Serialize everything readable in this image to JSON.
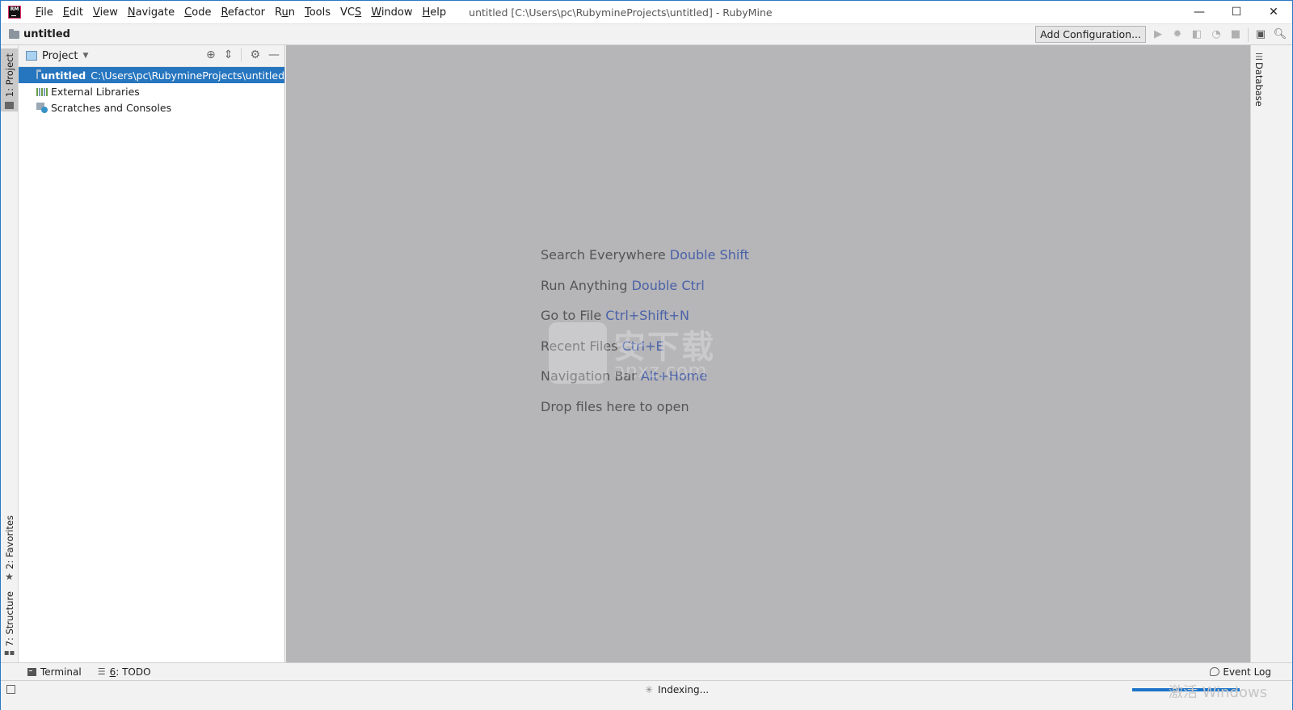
{
  "titlebar": {
    "app_logo": "RM",
    "menu": [
      {
        "label": "File",
        "mnemonic": "F",
        "rest": "ile"
      },
      {
        "label": "Edit",
        "mnemonic": "E",
        "rest": "dit"
      },
      {
        "label": "View",
        "mnemonic": "V",
        "rest": "iew"
      },
      {
        "label": "Navigate",
        "mnemonic": "N",
        "rest": "avigate"
      },
      {
        "label": "Code",
        "mnemonic": "C",
        "rest": "ode"
      },
      {
        "label": "Refactor",
        "mnemonic": "R",
        "rest": "efactor"
      },
      {
        "label": "Run",
        "pre": "R",
        "mnemonic": "u",
        "rest": "n"
      },
      {
        "label": "Tools",
        "mnemonic": "T",
        "rest": "ools"
      },
      {
        "label": "VCS",
        "pre": "VC",
        "mnemonic": "S",
        "rest": ""
      },
      {
        "label": "Window",
        "mnemonic": "W",
        "rest": "indow"
      },
      {
        "label": "Help",
        "mnemonic": "H",
        "rest": "elp"
      }
    ],
    "window_title": "untitled [C:\\Users\\pc\\RubymineProjects\\untitled] - RubyMine",
    "controls": {
      "minimize": "—",
      "maximize": "☐",
      "close": "✕"
    }
  },
  "navbar": {
    "breadcrumb": "untitled",
    "add_configuration": "Add Configuration...",
    "toolbar_icons": [
      "run-icon",
      "debug-icon",
      "coverage-icon",
      "profile-icon",
      "stop-icon",
      "project-structure-icon",
      "search-icon"
    ]
  },
  "left_strip": {
    "tabs": [
      {
        "label": "1: Project",
        "active": true
      },
      {
        "label": "2: Favorites",
        "active": false
      },
      {
        "label": "7: Structure",
        "active": false
      }
    ]
  },
  "project_panel": {
    "title": "Project",
    "tree": [
      {
        "name": "untitled",
        "path": "C:\\Users\\pc\\RubymineProjects\\untitled",
        "selected": true,
        "icon": "folder-icon"
      },
      {
        "name": "External Libraries",
        "path": "",
        "selected": false,
        "icon": "library-icon"
      },
      {
        "name": "Scratches and Consoles",
        "path": "",
        "selected": false,
        "icon": "scratches-icon"
      }
    ]
  },
  "editor": {
    "hints": [
      {
        "text": "Search Everywhere",
        "key": "Double Shift"
      },
      {
        "text": "Run Anything",
        "key": "Double Ctrl"
      },
      {
        "text": "Go to File",
        "key": "Ctrl+Shift+N"
      },
      {
        "text": "Recent Files",
        "key": "Ctrl+E"
      },
      {
        "text": "Navigation Bar",
        "key": "Alt+Home"
      },
      {
        "text": "Drop files here to open",
        "key": ""
      }
    ],
    "watermark_text": "安下载",
    "watermark_sub": "anxz.com",
    "key_color": "#4a62a8"
  },
  "right_strip": {
    "tabs": [
      {
        "label": "Database"
      }
    ]
  },
  "bottom_tabs": {
    "terminal": "Terminal",
    "todo_prefix": "6",
    "todo_label": ": TODO",
    "event_log": "Event Log"
  },
  "statusbar": {
    "indexing": "Indexing...",
    "progress": 0.95,
    "os_watermark": "激活 Windows"
  }
}
